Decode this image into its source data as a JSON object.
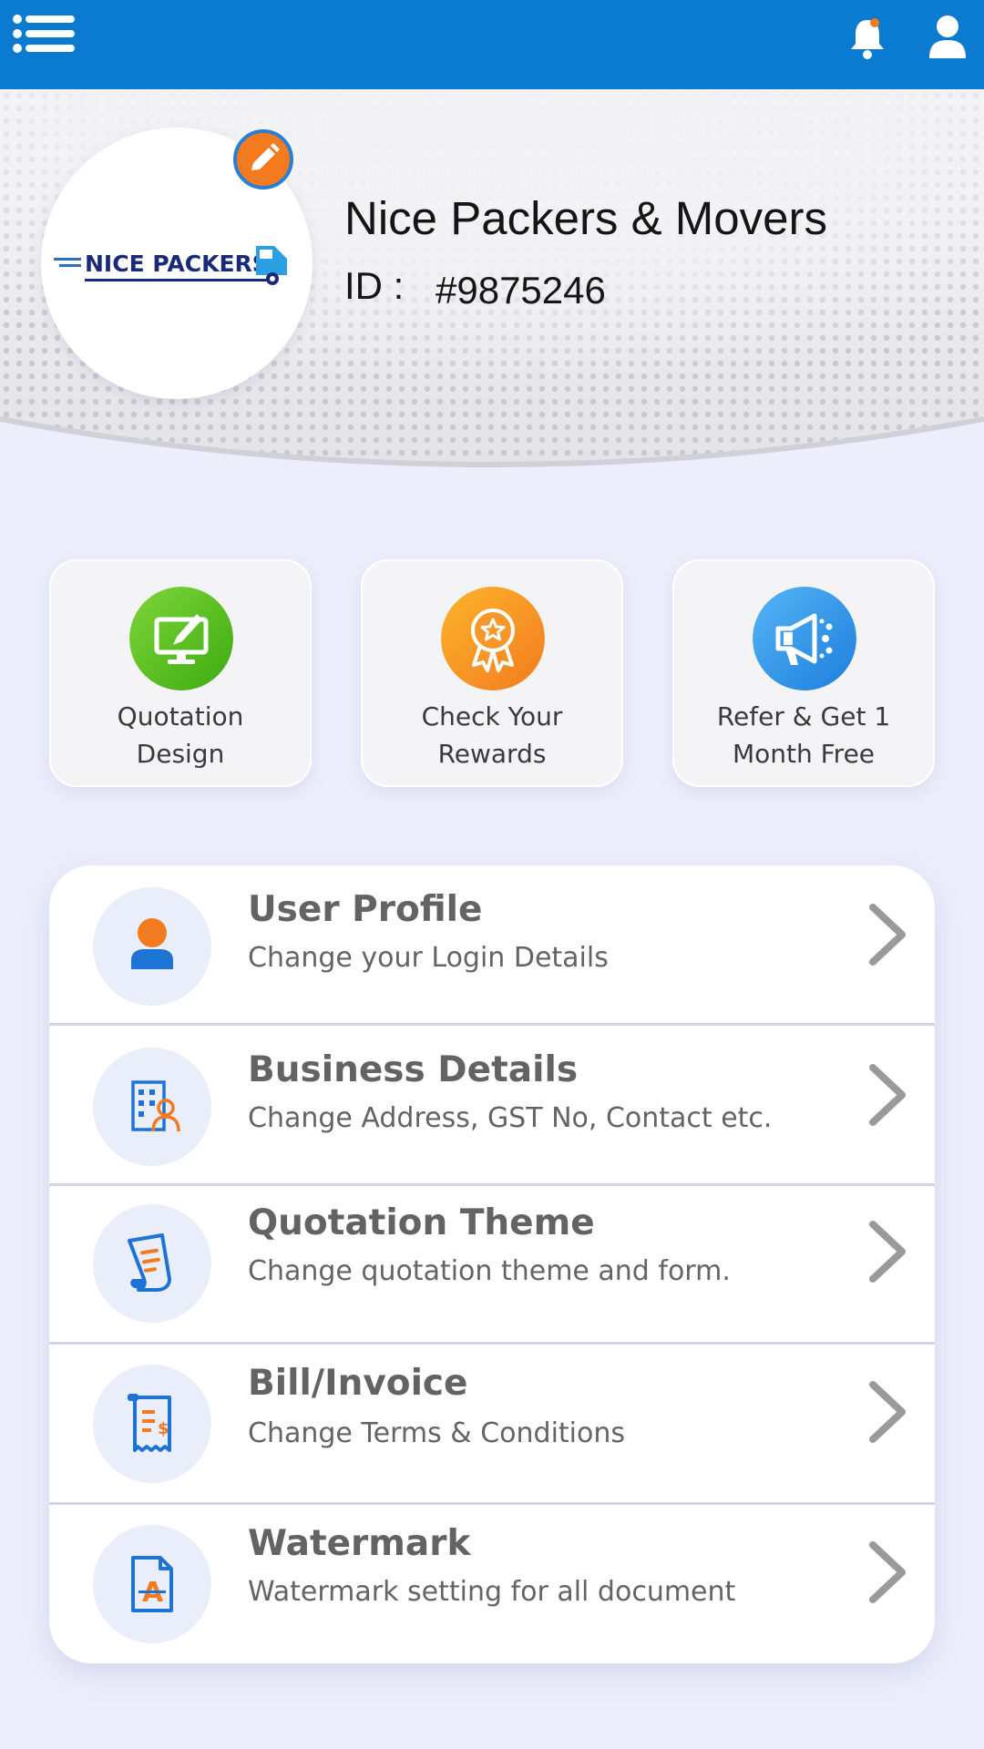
{
  "topbar": {
    "menu_icon": "hamburger-menu-icon",
    "bell_icon": "bell-notification-icon",
    "user_icon": "user-account-icon",
    "color": "#0a7bd1"
  },
  "profile": {
    "logo_text": "NICE PACKERS",
    "company_name": "Nice Packers & Movers",
    "id_label": "ID :",
    "id_value": "#9875246",
    "edit_icon": "pencil-icon",
    "edit_color": "#f47a20"
  },
  "quick_actions": [
    {
      "label": "Quotation\nDesign",
      "icon": "monitor-pen-icon",
      "color": "#5cc020"
    },
    {
      "label": "Check Your\nRewards",
      "icon": "award-ribbon-icon",
      "color": "#f79a1f"
    },
    {
      "label": "Refer & Get 1\nMonth Free",
      "icon": "megaphone-icon",
      "color": "#2f90e5"
    }
  ],
  "settings": [
    {
      "title": "User Profile",
      "subtitle": "Change your Login Details",
      "icon": "user-icon"
    },
    {
      "title": "Business Details",
      "subtitle": "Change Address, GST No, Contact etc.",
      "icon": "business-building-icon"
    },
    {
      "title": "Quotation Theme",
      "subtitle": "Change quotation theme and form.",
      "icon": "quotation-document-icon"
    },
    {
      "title": "Bill/Invoice",
      "subtitle": "Change Terms & Conditions",
      "icon": "invoice-receipt-icon"
    },
    {
      "title": "Watermark",
      "subtitle": "Watermark setting for all document",
      "icon": "watermark-document-icon"
    }
  ]
}
